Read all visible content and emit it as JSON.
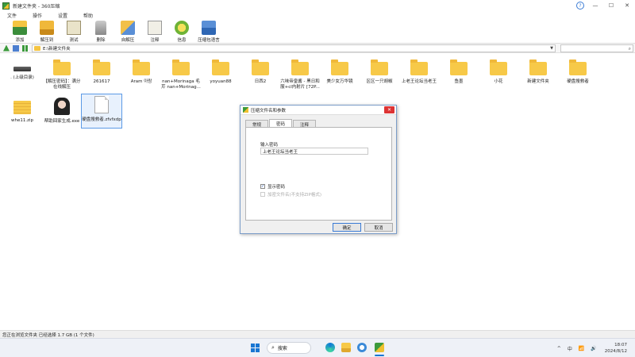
{
  "window": {
    "title": "新建文件夹 - 360压缩",
    "min": "—",
    "max": "☐",
    "close": "✕",
    "help": "?"
  },
  "menu": [
    "文件",
    "操作",
    "设置",
    "帮助"
  ],
  "toolbar": [
    {
      "label": "添加",
      "icon": "add-icon"
    },
    {
      "label": "解压到",
      "icon": "extract-to-icon"
    },
    {
      "label": "测试",
      "icon": "test-icon"
    },
    {
      "label": "删除",
      "icon": "delete-icon"
    },
    {
      "label": "自解压",
      "icon": "self-extract-icon"
    },
    {
      "label": "注释",
      "icon": "comment-icon"
    },
    {
      "label": "信息",
      "icon": "info-icon"
    },
    {
      "label": "压缩包语言",
      "icon": "language-icon"
    }
  ],
  "address": {
    "path": "E:\\新建文件夹",
    "search_placeholder": ""
  },
  "files": [
    {
      "name": ". (上级目录)",
      "type": "drive"
    },
    {
      "name": "【解压密码】：满分在线解压",
      "type": "folder"
    },
    {
      "name": "261617",
      "type": "folder"
    },
    {
      "name": "Aram 아람",
      "type": "folder"
    },
    {
      "name": "nan+Morinaga 毛芹 nan+Morinag...",
      "type": "folder"
    },
    {
      "name": "yoyuan88",
      "type": "folder"
    },
    {
      "name": "日西2",
      "type": "folder"
    },
    {
      "name": "六味帝皇酱 - 黑日和服+cl内射片 [72P...",
      "type": "folder"
    },
    {
      "name": "美少女万华镜",
      "type": "folder"
    },
    {
      "name": "区区一只胡椒",
      "type": "folder"
    },
    {
      "name": "上老王论坛当老王",
      "type": "folder"
    },
    {
      "name": "鱼墨",
      "type": "folder"
    },
    {
      "name": "小花",
      "type": "folder"
    },
    {
      "name": "新建文件夹",
      "type": "folder"
    },
    {
      "name": "硬盘搜救者",
      "type": "folder"
    },
    {
      "name": "whe11.zip",
      "type": "zip"
    },
    {
      "name": "帮助回家生成.exe",
      "type": "exe"
    },
    {
      "name": "硬盘搜救者.zfvfxdp",
      "type": "doc",
      "selected": true
    }
  ],
  "dialog": {
    "title": "压缩文件名和参数",
    "close": "✕",
    "tabs": [
      "常规",
      "密码",
      "注释"
    ],
    "active_tab": 1,
    "password_label": "输入密码",
    "password_value": "上老王论坛当老王",
    "show_password_label": "显示密码",
    "show_password_checked": true,
    "encrypt_names_label": "加密文件名(不支持ZIP格式)",
    "encrypt_names_checked": false,
    "ok": "确定",
    "cancel": "取消"
  },
  "status": "您正在浏览文件夹 已经选择 1.7 GB (1 个文件)",
  "taskbar": {
    "search_label": "搜索",
    "tray_up": "^",
    "tray_lang": "中",
    "tray_wifi": "📶",
    "tray_sound": "🔊",
    "time": "18:07",
    "date": "2024/8/12"
  },
  "colors": {
    "folder": "#f7c948",
    "accent": "#1976d2",
    "dialog_border": "#7a9cc8"
  }
}
